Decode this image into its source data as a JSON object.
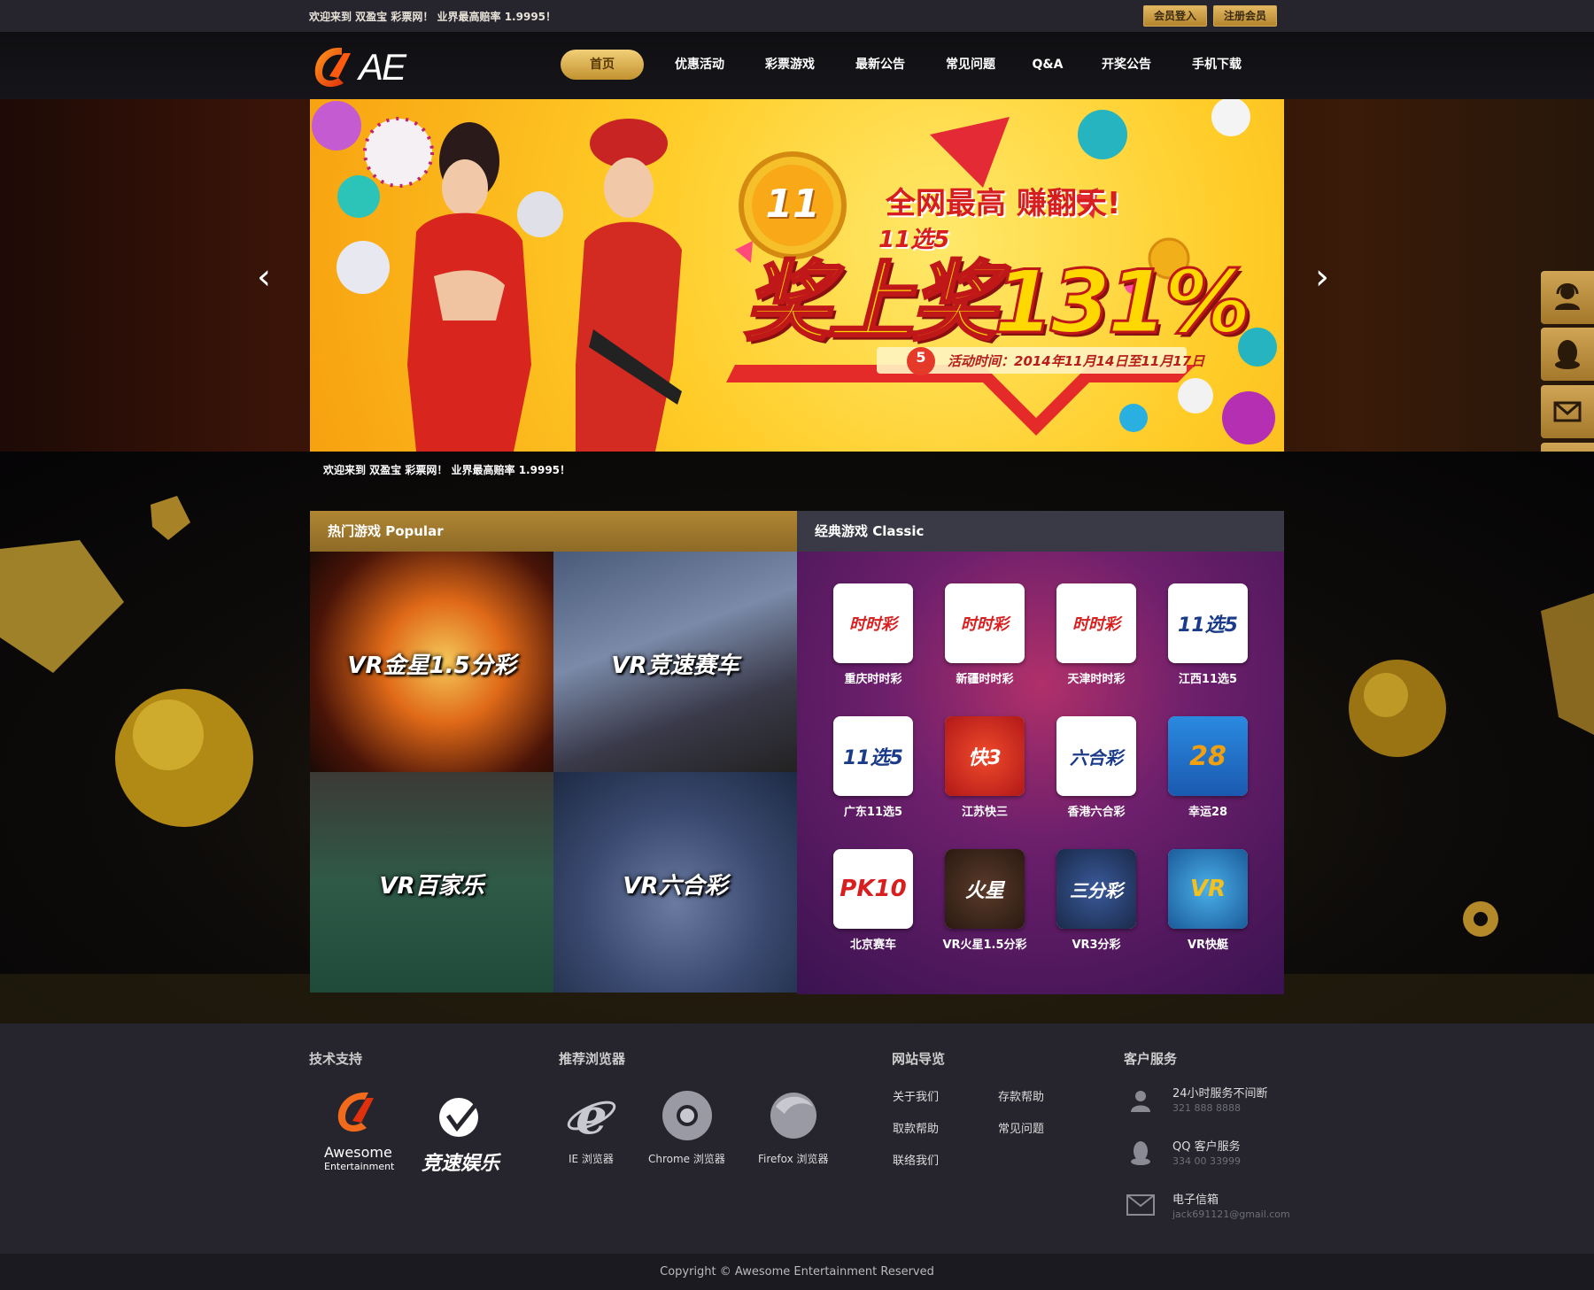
{
  "topbar": {
    "welcome": "欢迎来到 双盈宝 彩票网！ 业界最高赔率 1.9995！",
    "login": "会员登入",
    "register": "注册会员"
  },
  "logo": {
    "text": "AE"
  },
  "nav": {
    "items": [
      "首页",
      "优惠活动",
      "彩票游戏",
      "最新公告",
      "常见问题",
      "Q&A",
      "开奖公告",
      "手机下载"
    ],
    "active": "首页"
  },
  "banner": {
    "headline": "全网最高 赚翻天!",
    "game": "11选5",
    "big": "奖上奖131%",
    "badge": "11",
    "ball": "5",
    "date": "活动时间：2014年11月14日至11月17日"
  },
  "ticker": "欢迎来到 双盈宝 彩票网！ 业界最高赔率 1.9995！",
  "popular": {
    "title": "热门游戏 Popular",
    "tiles": [
      "VR金星1.5分彩",
      "VR竞速赛车",
      "VR百家乐",
      "VR六合彩"
    ]
  },
  "classic": {
    "title": "经典游戏 Classic",
    "games": [
      {
        "label": "重庆时时彩",
        "icon": "时时彩"
      },
      {
        "label": "新疆时时彩",
        "icon": "时时彩"
      },
      {
        "label": "天津时时彩",
        "icon": "时时彩"
      },
      {
        "label": "江西11选5",
        "icon": "11选5"
      },
      {
        "label": "广东11选5",
        "icon": "11选5"
      },
      {
        "label": "江苏快三",
        "icon": "快3"
      },
      {
        "label": "香港六合彩",
        "icon": "六合彩"
      },
      {
        "label": "幸运28",
        "icon": "28"
      },
      {
        "label": "北京赛车",
        "icon": "PK10"
      },
      {
        "label": "VR火星1.5分彩",
        "icon": "火星"
      },
      {
        "label": "VR3分彩",
        "icon": "三分彩"
      },
      {
        "label": "VR快艇",
        "icon": "VR"
      }
    ]
  },
  "footer": {
    "tech": {
      "title": "技术支持",
      "brand1_line1": "Awesome",
      "brand1_line2": "Entertainment",
      "brand2": "竞速娱乐"
    },
    "browsers": {
      "title": "推荐浏览器",
      "items": [
        "IE 浏览器",
        "Chrome 浏览器",
        "Firefox 浏览器"
      ]
    },
    "sitenav": {
      "title": "网站导览",
      "links": [
        "关于我们",
        "存款帮助",
        "取款帮助",
        "常见问题",
        "联络我们"
      ]
    },
    "service": {
      "title": "客户服务",
      "items": [
        {
          "label": "24小时服务不间断",
          "sub": "321 888 8888"
        },
        {
          "label": "QQ 客户服务",
          "sub": "334 00 33999"
        },
        {
          "label": "电子信箱",
          "sub": "jack691121@gmail.com"
        }
      ]
    }
  },
  "copyright": "Copyright © Awesome Entertainment Reserved",
  "colors": {
    "gold": "#c9a24e",
    "classic_purple": "#6c1f6c",
    "footer": "#26252d"
  }
}
